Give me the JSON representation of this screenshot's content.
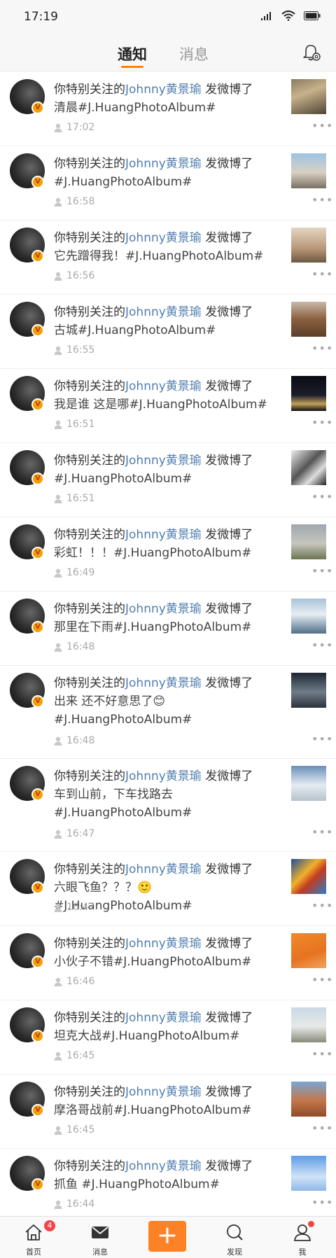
{
  "status_bar": {
    "time": "17:19"
  },
  "header": {
    "tabs": [
      "通知",
      "消息"
    ]
  },
  "feed": {
    "items": [
      {
        "prefix": "你特别关注的",
        "user": "Johnny黄景瑜",
        "suffix": " 发微博了",
        "text": "清晨#J.HuangPhotoAlbum#",
        "time": "17:02",
        "thumb": "street-photo"
      },
      {
        "prefix": "你特别关注的",
        "user": "Johnny黄景瑜",
        "suffix": " 发微博了",
        "text": "#J.HuangPhotoAlbum#",
        "time": "16:58",
        "thumb": "city-photo"
      },
      {
        "prefix": "你特别关注的",
        "user": "Johnny黄景瑜",
        "suffix": " 发微博了",
        "text": "它先蹭得我！#J.HuangPhotoAlbum#",
        "time": "16:56",
        "thumb": "person-photo"
      },
      {
        "prefix": "你特别关注的",
        "user": "Johnny黄景瑜",
        "suffix": " 发微博了",
        "text": "古城#J.HuangPhotoAlbum#",
        "time": "16:55",
        "thumb": "ancient-city-photo"
      },
      {
        "prefix": "你特别关注的",
        "user": "Johnny黄景瑜",
        "suffix": " 发微博了",
        "text": "我是谁 这是哪#J.HuangPhotoAlbum#",
        "time": "16:51",
        "thumb": "night-photo"
      },
      {
        "prefix": "你特别关注的",
        "user": "Johnny黄景瑜",
        "suffix": " 发微博了",
        "text": "#J.HuangPhotoAlbum#",
        "time": "16:51",
        "thumb": "bw-photo"
      },
      {
        "prefix": "你特别关注的",
        "user": "Johnny黄景瑜",
        "suffix": " 发微博了",
        "text": "彩虹！！！#J.HuangPhotoAlbum#",
        "time": "16:49",
        "thumb": "rainbow-photo"
      },
      {
        "prefix": "你特别关注的",
        "user": "Johnny黄景瑜",
        "suffix": " 发微博了",
        "text": "那里在下雨#J.HuangPhotoAlbum#",
        "time": "16:48",
        "thumb": "sea-photo"
      },
      {
        "prefix": "你特别关注的",
        "user": "Johnny黄景瑜",
        "suffix": " 发微博了",
        "text": "出来 还不好意思了😊 #J.HuangPhotoAlbum#",
        "time": "16:48",
        "thumb": "sunset-photo"
      },
      {
        "prefix": "你特别关注的",
        "user": "Johnny黄景瑜",
        "suffix": " 发微博了",
        "text": "车到山前，下车找路去 #J.HuangPhotoAlbum#",
        "time": "16:47",
        "thumb": "snow-photo"
      },
      {
        "prefix": "你特别关注的",
        "user": "Johnny黄景瑜",
        "suffix": " 发微博了",
        "text": "六眼飞鱼？？？🙂#J.HuangPhotoAlbum#",
        "time": "16:47",
        "thumb": "kite-photo"
      },
      {
        "prefix": "你特别关注的",
        "user": "Johnny黄景瑜",
        "suffix": " 发微博了",
        "text": "小伙子不错#J.HuangPhotoAlbum#",
        "time": "16:46",
        "thumb": "silhouette-photo"
      },
      {
        "prefix": "你特别关注的",
        "user": "Johnny黄景瑜",
        "suffix": " 发微博了",
        "text": "坦克大战#J.HuangPhotoAlbum#",
        "time": "16:45",
        "thumb": "tank-photo"
      },
      {
        "prefix": "你特别关注的",
        "user": "Johnny黄景瑜",
        "suffix": " 发微博了",
        "text": "摩洛哥战前#J.HuangPhotoAlbum#",
        "time": "16:45",
        "thumb": "morocco-photo"
      },
      {
        "prefix": "你特别关注的",
        "user": "Johnny黄景瑜",
        "suffix": " 发微博了",
        "text": "抓鱼 #J.HuangPhotoAlbum#",
        "time": "16:44",
        "thumb": "sky-photo"
      }
    ]
  },
  "tabbar": {
    "home": "首页",
    "home_badge": "4",
    "messages": "消息",
    "plus": "+",
    "discover": "发现",
    "me": "我"
  }
}
